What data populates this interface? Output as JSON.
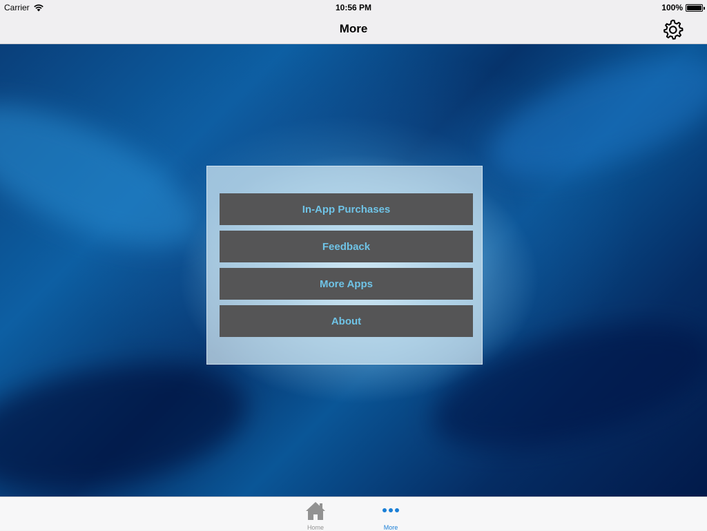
{
  "status_bar": {
    "carrier": "Carrier",
    "time": "10:56 PM",
    "battery_percent": "100%",
    "battery_level": 1.0
  },
  "nav": {
    "title": "More",
    "settings_icon": "gear-icon"
  },
  "menu": {
    "items": [
      {
        "label": "In-App Purchases"
      },
      {
        "label": "Feedback"
      },
      {
        "label": "More Apps"
      },
      {
        "label": "About"
      }
    ]
  },
  "tabs": [
    {
      "label": "Home",
      "icon": "home-icon",
      "selected": false
    },
    {
      "label": "More",
      "icon": "more-dots-icon",
      "selected": true
    }
  ],
  "colors": {
    "accent": "#1a7fd6",
    "menu_text": "#6fc3e6",
    "menu_button_bg": "#555556",
    "tab_inactive": "#929292"
  }
}
